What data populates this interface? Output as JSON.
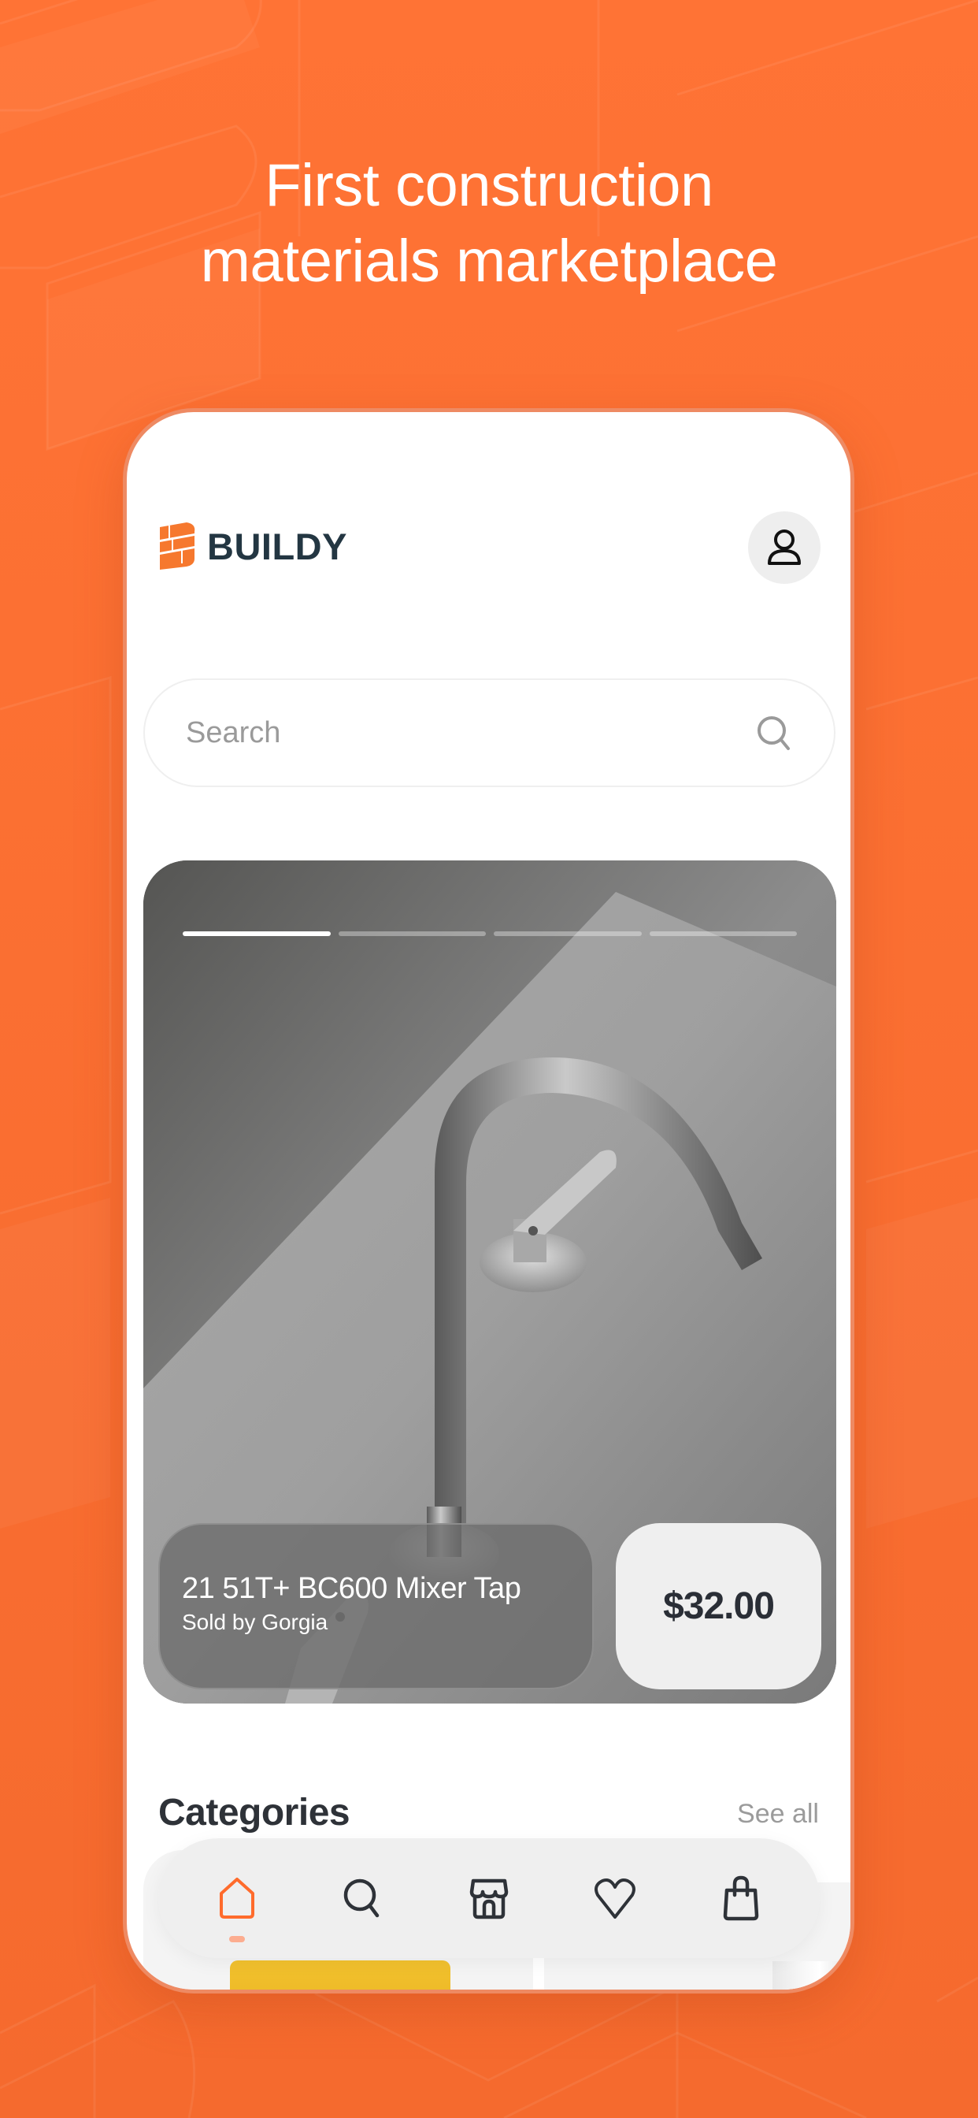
{
  "colors": {
    "brand_orange": "#FF7133",
    "dark_text": "#233642",
    "price_text": "#2A2E36",
    "muted_text": "#9B9B9B"
  },
  "headline": {
    "line1": "First construction",
    "line2": "materials marketplace"
  },
  "app": {
    "brand": "BUILDY",
    "profile_icon": "user-icon"
  },
  "search": {
    "placeholder": "Search",
    "value": "",
    "icon": "search-icon"
  },
  "hero": {
    "slide_count": 4,
    "active_slide": 1,
    "product_name": "21 51T+ BC600 Mixer Tap",
    "seller": "Sold by Gorgia",
    "price": "$32.00",
    "image": "mixer-tap-photo"
  },
  "categories": {
    "title": "Categories",
    "see_all_label": "See all"
  },
  "bottom_nav": {
    "active": "home",
    "items": [
      {
        "id": "home",
        "icon": "home-icon"
      },
      {
        "id": "search",
        "icon": "search-icon"
      },
      {
        "id": "store",
        "icon": "store-icon"
      },
      {
        "id": "favorites",
        "icon": "heart-icon"
      },
      {
        "id": "cart",
        "icon": "shopping-bag-icon"
      }
    ]
  }
}
